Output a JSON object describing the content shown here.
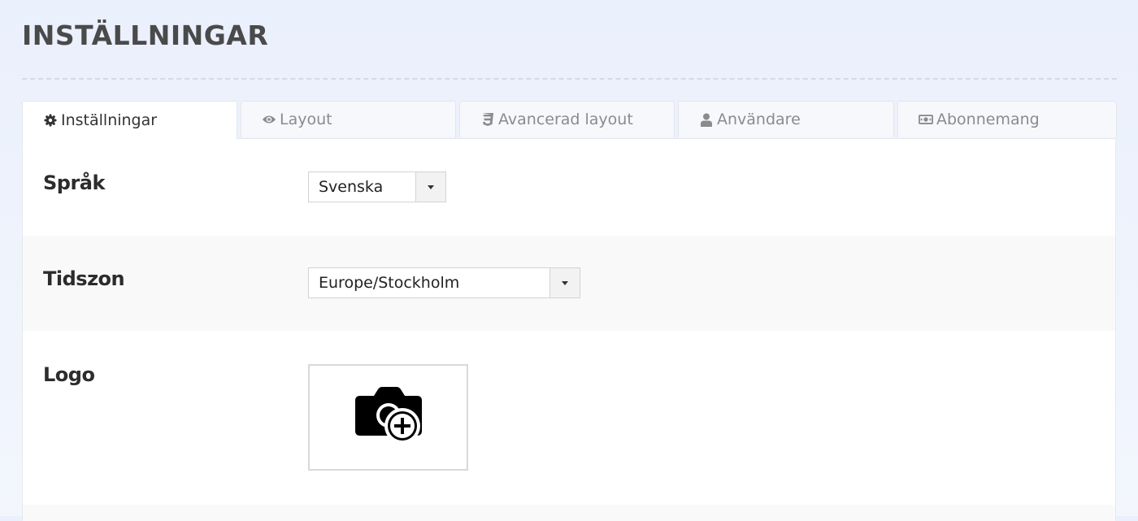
{
  "page": {
    "title": "INSTÄLLNINGAR"
  },
  "tabs": [
    {
      "label": "Inställningar",
      "icon": "gear-icon",
      "active": true
    },
    {
      "label": "Layout",
      "icon": "eye-icon",
      "active": false
    },
    {
      "label": "Avancerad layout",
      "icon": "css3-icon",
      "active": false
    },
    {
      "label": "Användare",
      "icon": "user-icon",
      "active": false
    },
    {
      "label": "Abonnemang",
      "icon": "money-bill-icon",
      "active": false
    }
  ],
  "settings": {
    "language": {
      "label": "Språk",
      "value": "Svenska"
    },
    "timezone": {
      "label": "Tidszon",
      "value": "Europe/Stockholm"
    },
    "logo": {
      "label": "Logo",
      "icon": "camera-plus-icon"
    }
  },
  "colors": {
    "background": "#eaf0fc",
    "panel": "#ffffff",
    "alt_row": "#f9f9f9",
    "inactive_tab_text": "#8b8b8b"
  }
}
